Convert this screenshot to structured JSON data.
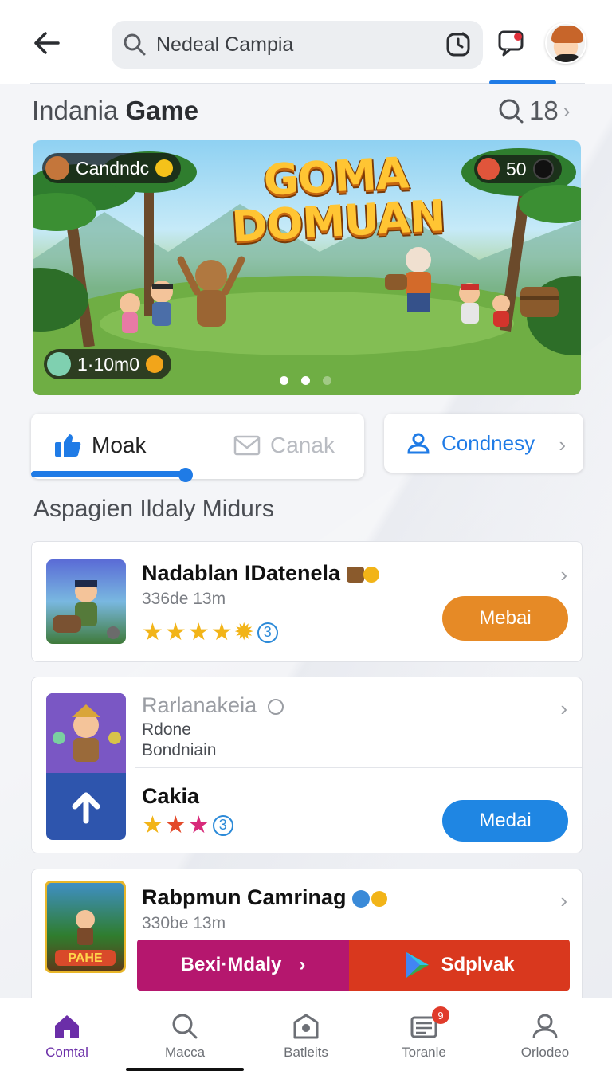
{
  "header": {
    "search_value": "Nedeal Campia",
    "accent": "#1f7be6"
  },
  "section": {
    "title_light": "Indania",
    "title_bold": "Game",
    "count": "18"
  },
  "banner": {
    "title_line1": "GOMA",
    "title_line2": "DOMUAN",
    "player_name": "Candndc",
    "score": "50",
    "prize": "1·10m0",
    "active_slide": 2,
    "slide_count": 3
  },
  "tabs": {
    "tab1": "Moak",
    "tab2": "Canak",
    "progress_fraction": 0.49,
    "side_button": "Condnesy"
  },
  "list_title": "Aspagien Ildaly Midurs",
  "cards": [
    {
      "name": "Nadablan IDatenela",
      "sub": "336de 13m",
      "rating_badge": "3",
      "button": "Mebai",
      "button_color": "#e68a26"
    },
    {
      "top_name": "Rarlanakeia",
      "line1": "Rdone",
      "line2": "Bondniain",
      "name": "Cakia",
      "rating_badge": "3",
      "button": "Medai",
      "button_color": "#1f86e3"
    },
    {
      "name": "Rabpmun Camrinag",
      "sub": "330be 13m",
      "thumb_label": "PAHE",
      "button1": "Bexi·Mdaly",
      "button2": "Sdplvak",
      "button1_color": "#b5176e",
      "button2_color": "#d9381e"
    }
  ],
  "nav": [
    {
      "label": "Comtal",
      "icon": "home-icon",
      "active": true
    },
    {
      "label": "Macca",
      "icon": "search-icon"
    },
    {
      "label": "Batleits",
      "icon": "shop-icon"
    },
    {
      "label": "Toranle",
      "icon": "news-icon",
      "badge": "9"
    },
    {
      "label": "Orlodeo",
      "icon": "profile-icon"
    }
  ]
}
